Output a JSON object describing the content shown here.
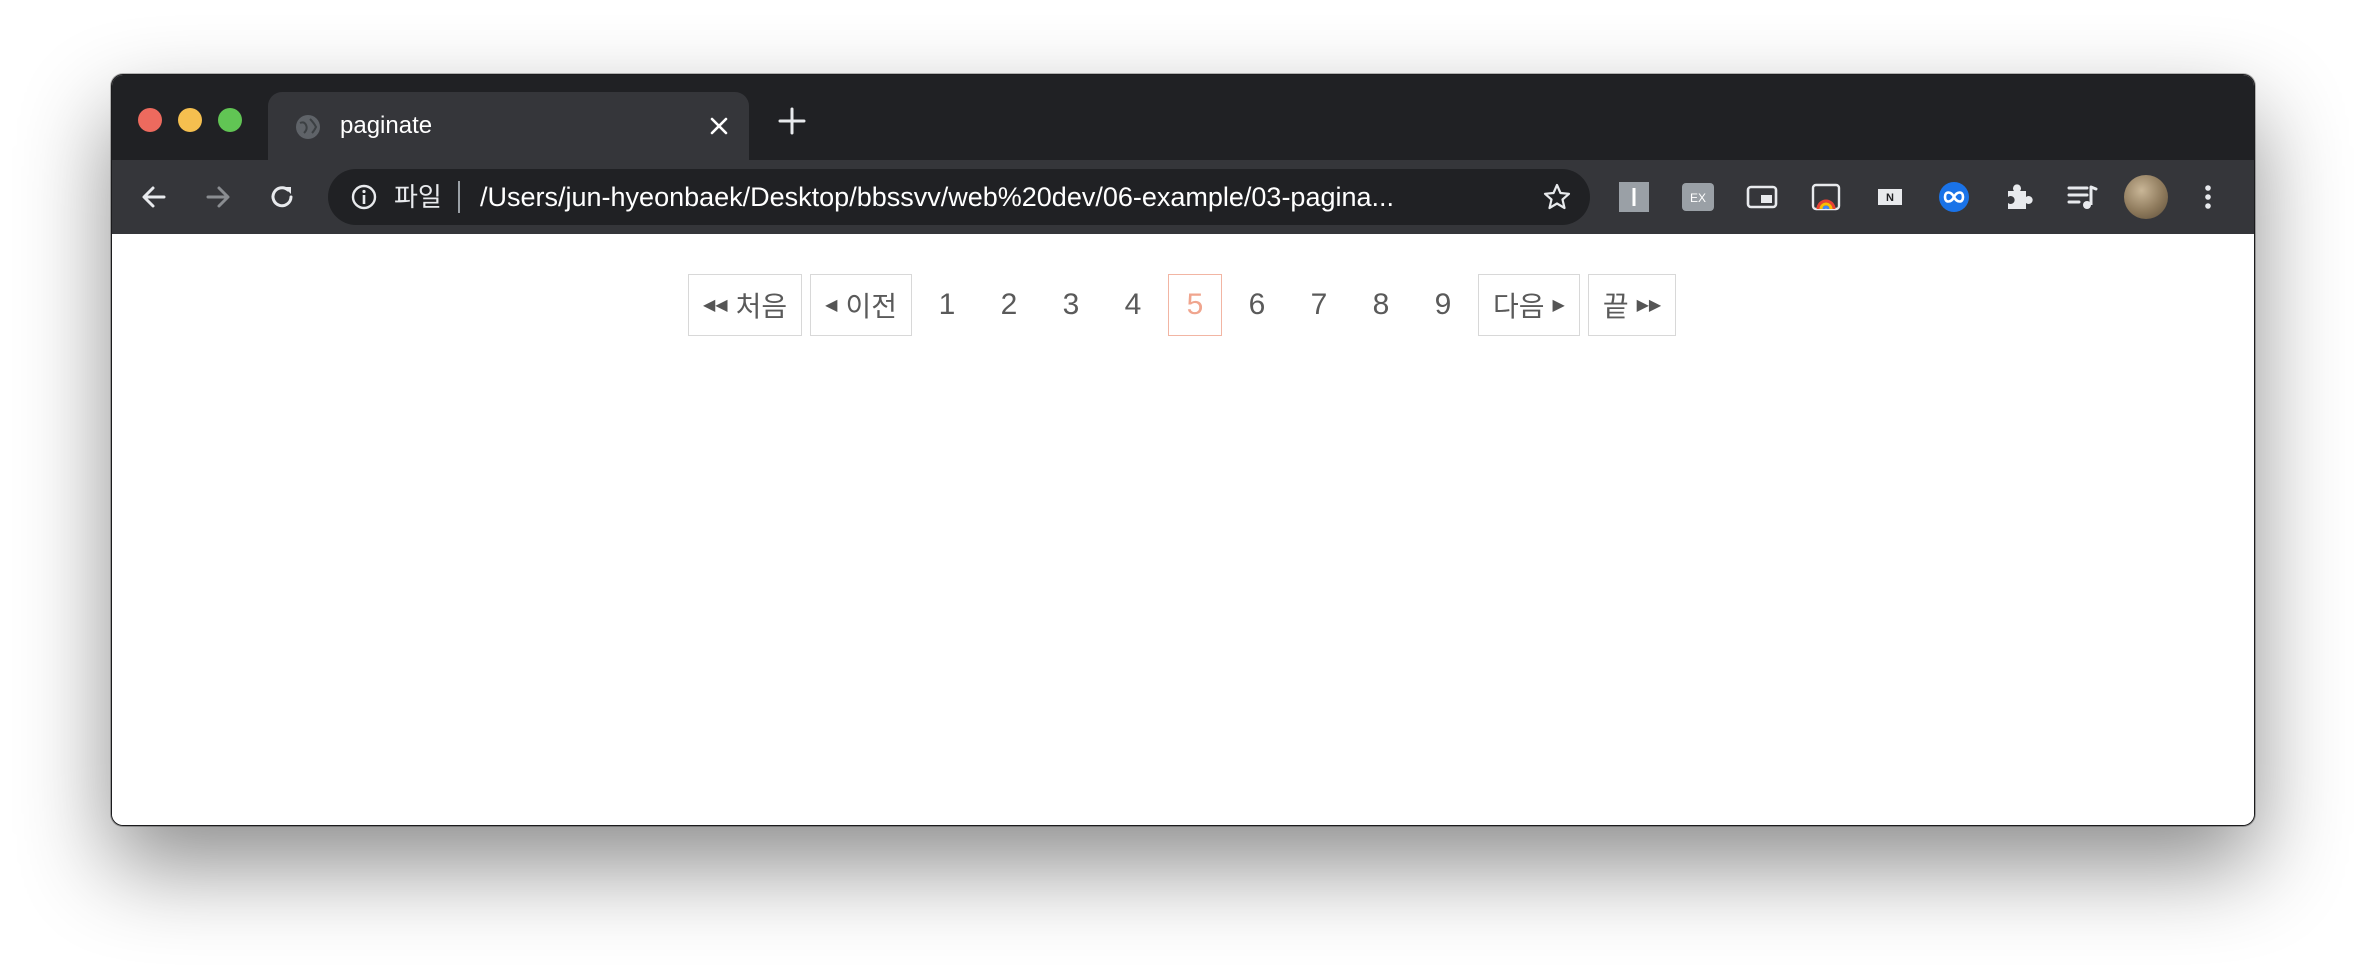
{
  "browser": {
    "tab_title": "paginate",
    "address": {
      "scheme_label": "파일",
      "url": "/Users/jun-hyeonbaek/Desktop/bbssvv/web%20dev/06-example/03-pagina..."
    },
    "extensions": [
      "I",
      "EX",
      "picture-in-picture",
      "rainbow-extension",
      "N-extension",
      "infinity-extension",
      "puzzle",
      "media-playlist"
    ]
  },
  "pagination": {
    "first_label": "처음",
    "prev_label": "이전",
    "next_label": "다음",
    "last_label": "끝",
    "pages": [
      "1",
      "2",
      "3",
      "4",
      "5",
      "6",
      "7",
      "8",
      "9"
    ],
    "current_page": "5",
    "accent_color": "#f0a58e"
  }
}
